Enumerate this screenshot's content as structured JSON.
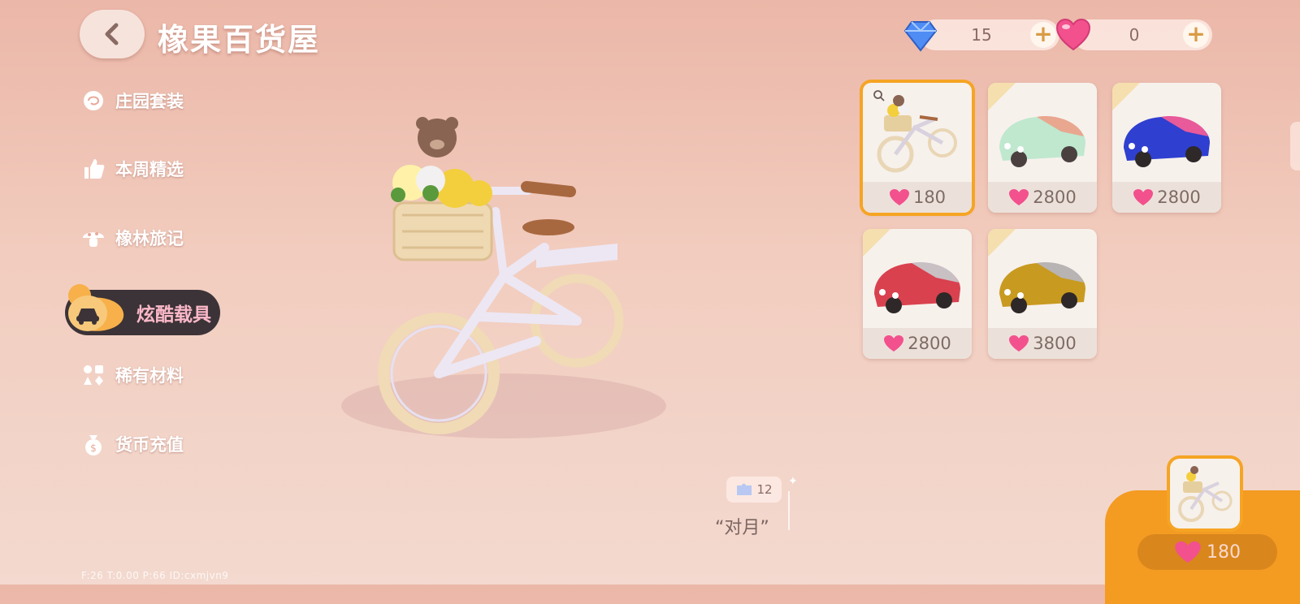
{
  "header": {
    "title": "橡果百货屋"
  },
  "currencies": [
    {
      "icon": "blue-diamond-icon",
      "value": "15"
    },
    {
      "icon": "pink-heart-gem-icon",
      "value": "0"
    }
  ],
  "sidebar": {
    "items": [
      {
        "label": "庄园套装",
        "icon": "rose-icon"
      },
      {
        "label": "本周精选",
        "icon": "thumbs-up-icon"
      },
      {
        "label": "橡林旅记",
        "icon": "mushroom-icon"
      },
      {
        "label": "炫酷载具",
        "icon": "car-icon",
        "active": true
      },
      {
        "label": "稀有材料",
        "icon": "materials-icon"
      },
      {
        "label": "货币充值",
        "icon": "money-bag-icon"
      }
    ]
  },
  "items": [
    {
      "name": "bicycle",
      "price": "180",
      "selected": true
    },
    {
      "name": "mint-convertible",
      "price": "2800"
    },
    {
      "name": "blue-convertible",
      "price": "2800"
    },
    {
      "name": "red-convertible",
      "price": "2800"
    },
    {
      "name": "gold-convertible",
      "price": "3800"
    }
  ],
  "preview": {
    "collect_count": "12",
    "item_name": "“对月”"
  },
  "purchase": {
    "price": "180"
  },
  "debug": "F:26   T:0.00   P:66   ID:cxmjvn9",
  "colors": {
    "accent_orange": "#f49b22",
    "sidebar_active_bg": "#3b3337",
    "sidebar_active_text": "#fbb8c9"
  }
}
